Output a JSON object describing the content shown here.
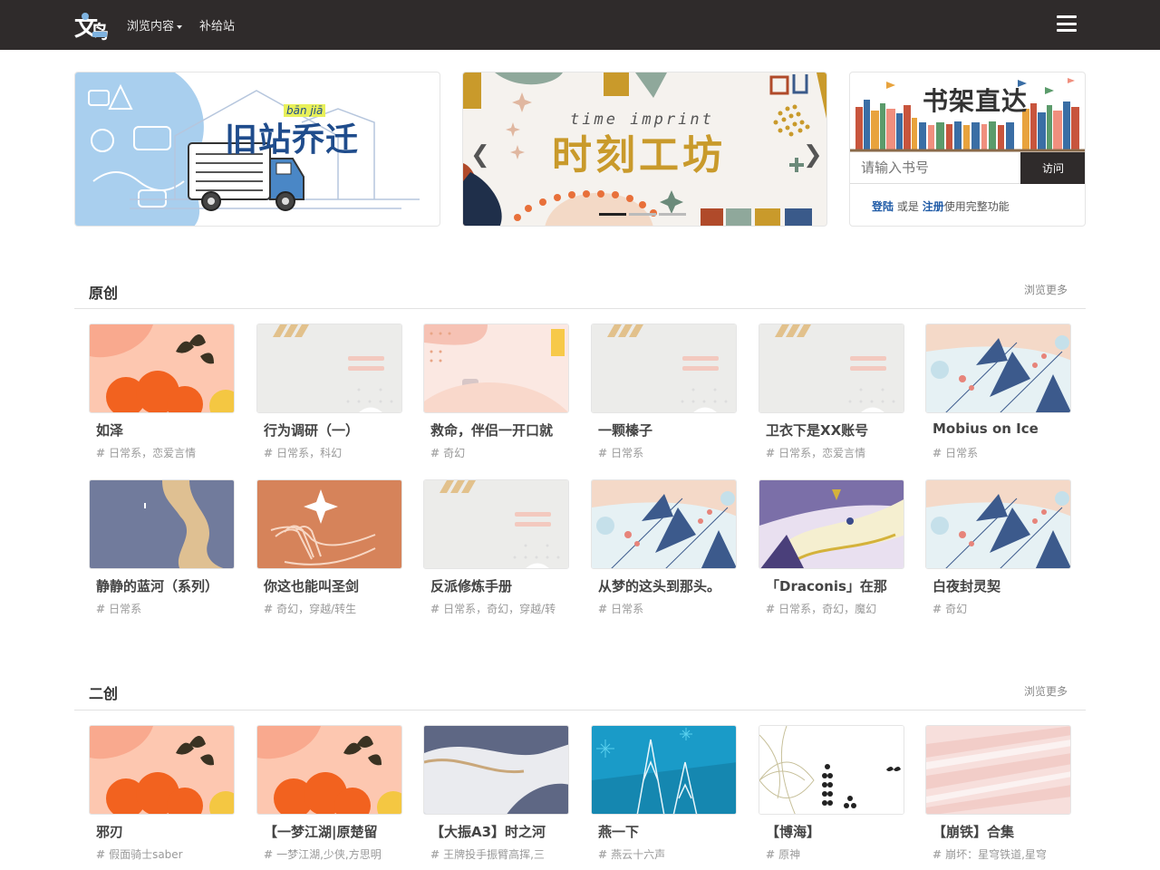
{
  "navbar": {
    "browse_label": "浏览内容",
    "supply_label": "补给站"
  },
  "banners": {
    "moving": {
      "title": "旧站乔迁",
      "subtitle": "bān jiā"
    },
    "workshop": {
      "title": "时刻工坊",
      "subtitle": "time imprint"
    },
    "bookshelf": {
      "title": "书架直达",
      "input_placeholder": "请输入书号",
      "visit_label": "访问",
      "login_label": "登陆",
      "or_label": "或是",
      "register_label": "注册",
      "suffix_label": "使用完整功能"
    }
  },
  "sections": [
    {
      "title": "原创",
      "more_label": "浏览更多",
      "cards": [
        {
          "title": "如泽",
          "tags": "日常系，恋爱言情",
          "thumb": "orange-flower"
        },
        {
          "title": "行为调研（一）",
          "tags": "日常系，科幻",
          "thumb": "placeholder-gray"
        },
        {
          "title": "救命，伴侣一开口就",
          "tags": "奇幻",
          "thumb": "pink-abstract"
        },
        {
          "title": "一颗榛子",
          "tags": "日常系",
          "thumb": "placeholder-gray"
        },
        {
          "title": "卫衣下是XX账号",
          "tags": "日常系，恋爱言情",
          "thumb": "placeholder-gray"
        },
        {
          "title": "Mobius on Ice",
          "tags": "日常系",
          "thumb": "blue-leaves"
        },
        {
          "title": "静静的蓝河（系列）",
          "tags": "日常系",
          "thumb": "slate-wave"
        },
        {
          "title": "你这也能叫圣剑",
          "tags": "奇幻，穿越/转生",
          "thumb": "orange-hand"
        },
        {
          "title": "反派修炼手册",
          "tags": "日常系，奇幻，穿越/转",
          "thumb": "placeholder-gray"
        },
        {
          "title": "从梦的这头到那头。",
          "tags": "日常系",
          "thumb": "blue-leaves"
        },
        {
          "title": "「Draconis」在那",
          "tags": "日常系，奇幻，魔幻",
          "thumb": "dragon"
        },
        {
          "title": "白夜封灵契",
          "tags": "奇幻",
          "thumb": "blue-leaves"
        }
      ]
    },
    {
      "title": "二创",
      "more_label": "浏览更多",
      "cards": [
        {
          "title": "邪刃",
          "tags": "假面骑士saber",
          "thumb": "orange-flower"
        },
        {
          "title": "【一梦江湖|原楚留",
          "tags": "一梦江湖,少侠,方思明",
          "thumb": "orange-flower"
        },
        {
          "title": "【大振A3】时之河",
          "tags": "王牌投手振臂高挥,三",
          "thumb": "slate-wave-light"
        },
        {
          "title": "燕一下",
          "tags": "燕云十六声",
          "thumb": "teal-trees"
        },
        {
          "title": "【博海】",
          "tags": "原神",
          "thumb": "line-flower"
        },
        {
          "title": "【崩铁】合集",
          "tags": "崩坏：星穹铁道,星穹",
          "thumb": "pink-stripes"
        }
      ]
    }
  ],
  "colors": {
    "navbar_bg": "#2f2b2b",
    "link_blue": "#1e5aa6",
    "workshop_gold": "#c99a2b",
    "moving_blue": "#1f4c8c"
  },
  "icons": {
    "logo": "wenqiu-logo",
    "menu": "hamburger-icon",
    "carousel_prev": "chevron-left-icon",
    "carousel_next": "chevron-right-icon",
    "tag": "hash-icon"
  }
}
